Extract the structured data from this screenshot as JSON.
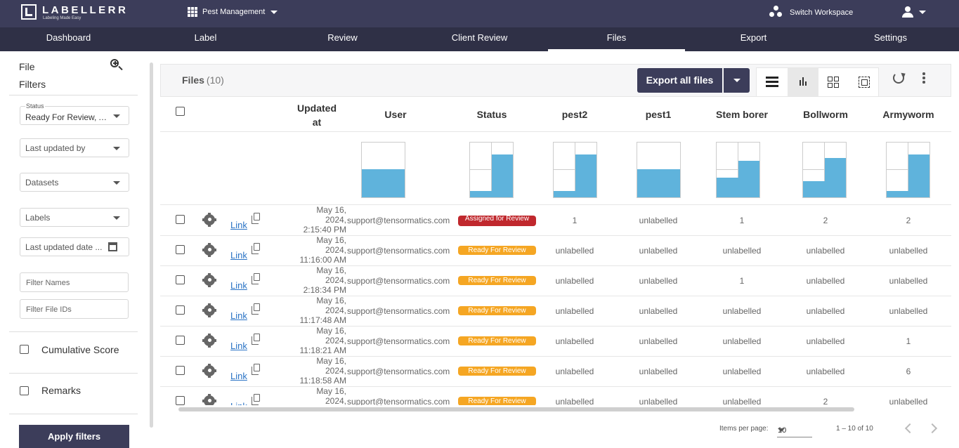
{
  "brand": {
    "name": "LABELLERR",
    "tagline": "Labeling Made Easy"
  },
  "topbar": {
    "project": "Pest Management",
    "switch_workspace": "Switch Workspace"
  },
  "nav": {
    "items": [
      "Dashboard",
      "Label",
      "Review",
      "Client Review",
      "Files",
      "Export",
      "Settings"
    ],
    "active": "Files"
  },
  "sidebar": {
    "title_line1": "File",
    "title_line2": "Filters",
    "status_caption": "Status",
    "status_value": "Ready For Review, Assigned for Review",
    "last_updated_by": "Last updated by",
    "datasets": "Datasets",
    "labels": "Labels",
    "last_updated_date": "Last updated date ...",
    "filter_names": "Filter Names",
    "filter_file_ids": "Filter File IDs",
    "cumulative_score": "Cumulative Score",
    "remarks": "Remarks",
    "apply": "Apply filters"
  },
  "files": {
    "title": "Files",
    "count": "(10)",
    "export_all": "Export all files"
  },
  "table": {
    "columns": {
      "updated_line1": "Updated",
      "updated_line2": "at",
      "user": "User",
      "status": "Status",
      "c1": "pest2",
      "c2": "pest1",
      "c3": "Stem borer",
      "c4": "Bollworm",
      "c5": "Armyworm"
    },
    "link_label": "Link",
    "rows": [
      {
        "d1": "May 16,",
        "d2": "2024,",
        "d3": "2:15:40 PM",
        "user": "support@tensormatics.com",
        "status": "Assigned for Review",
        "status_color": "#c0282d",
        "c1": "1",
        "c2": "unlabelled",
        "c3": "1",
        "c4": "2",
        "c5": "2"
      },
      {
        "d1": "May 16,",
        "d2": "2024,",
        "d3": "11:16:00 AM",
        "user": "support@tensormatics.com",
        "status": "Ready For Review",
        "status_color": "#f5a623",
        "c1": "unlabelled",
        "c2": "unlabelled",
        "c3": "unlabelled",
        "c4": "unlabelled",
        "c5": "unlabelled"
      },
      {
        "d1": "May 16,",
        "d2": "2024,",
        "d3": "2:18:34 PM",
        "user": "support@tensormatics.com",
        "status": "Ready For Review",
        "status_color": "#f5a623",
        "c1": "unlabelled",
        "c2": "unlabelled",
        "c3": "1",
        "c4": "unlabelled",
        "c5": "unlabelled"
      },
      {
        "d1": "May 16,",
        "d2": "2024,",
        "d3": "11:17:48 AM",
        "user": "support@tensormatics.com",
        "status": "Ready For Review",
        "status_color": "#f5a623",
        "c1": "unlabelled",
        "c2": "unlabelled",
        "c3": "unlabelled",
        "c4": "unlabelled",
        "c5": "unlabelled"
      },
      {
        "d1": "May 16,",
        "d2": "2024,",
        "d3": "11:18:21 AM",
        "user": "support@tensormatics.com",
        "status": "Ready For Review",
        "status_color": "#f5a623",
        "c1": "unlabelled",
        "c2": "unlabelled",
        "c3": "unlabelled",
        "c4": "unlabelled",
        "c5": "1"
      },
      {
        "d1": "May 16,",
        "d2": "2024,",
        "d3": "11:18:58 AM",
        "user": "support@tensormatics.com",
        "status": "Ready For Review",
        "status_color": "#f5a623",
        "c1": "unlabelled",
        "c2": "unlabelled",
        "c3": "unlabelled",
        "c4": "unlabelled",
        "c5": "6"
      },
      {
        "d1": "May 16,",
        "d2": "2024,",
        "d3": "",
        "user": "support@tensormatics.com",
        "status": "Ready For Review",
        "status_color": "#f5a623",
        "c1": "unlabelled",
        "c2": "unlabelled",
        "c3": "unlabelled",
        "c4": "2",
        "c5": "unlabelled"
      }
    ]
  },
  "pagination": {
    "items_per_page_label": "Items per page:",
    "items_per_page": "10",
    "range": "1 – 10 of 10"
  },
  "colors": {
    "header": "#3c3d5a",
    "nav": "#2f3046",
    "bar": "#5fb3dc",
    "ready": "#f5a623",
    "assigned": "#c0282d"
  }
}
